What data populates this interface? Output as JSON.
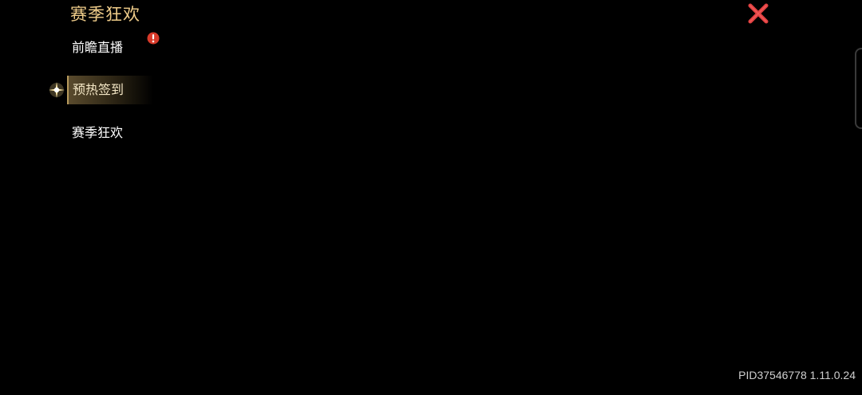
{
  "panel": {
    "title": "赛季狂欢"
  },
  "menu": {
    "items": [
      {
        "label": "前瞻直播",
        "alert": true
      },
      {
        "label": "预热签到",
        "active": true
      },
      {
        "label": "赛季狂欢"
      }
    ]
  },
  "footer": {
    "build": "PID37546778 1.11.0.24"
  },
  "icons": {
    "close": "close-icon",
    "alert": "alert-icon",
    "sparkle": "sparkle-icon"
  },
  "colors": {
    "background": "#000000",
    "title": "#f0cd8a",
    "close": "#e04040",
    "alert": "#d83a2a",
    "active_bg": "#786440"
  }
}
